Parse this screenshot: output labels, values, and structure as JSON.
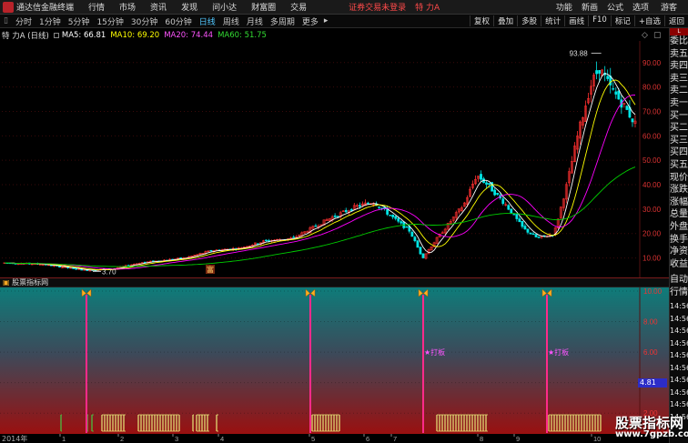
{
  "menu": {
    "app_title": "通达信金融终端",
    "items": [
      "行情",
      "市场",
      "资讯",
      "发现",
      "问小达",
      "财富圈",
      "交易"
    ],
    "warning": "证券交易未登录",
    "stock_name": "特 力A",
    "right_items": [
      "功能",
      "新画",
      "公式",
      "选项",
      "游客"
    ]
  },
  "periods": {
    "items": [
      "分时",
      "1分钟",
      "5分钟",
      "15分钟",
      "30分钟",
      "60分钟",
      "日线",
      "周线",
      "月线",
      "多周期",
      "更多"
    ],
    "active": "日线"
  },
  "tools": [
    "复权",
    "叠加",
    "多股",
    "统计",
    "画线",
    "F10",
    "标记",
    "+自选",
    "返回"
  ],
  "legend": {
    "title": "特 力A (日线)",
    "ma5": "MA5: 66.81",
    "ma10": "MA10: 69.20",
    "ma20": "MA20: 74.44",
    "ma60": "MA60: 51.75"
  },
  "price_axis": [
    "90.00",
    "80.00",
    "70.00",
    "60.00",
    "50.00",
    "40.00",
    "30.00",
    "20.00",
    "10.00"
  ],
  "annotations": {
    "high": "93.88",
    "low": "3.70",
    "ma_marker": "富"
  },
  "indicator": {
    "title": "股票指标网",
    "axis": [
      "10.00",
      "8.00",
      "6.00",
      "4.00",
      "2.00"
    ],
    "current": "4.81",
    "signal_label": "打板"
  },
  "side_panel": {
    "top": "L",
    "labels": [
      "委比",
      "卖五",
      "卖四",
      "卖三",
      "卖二",
      "卖一",
      "买一",
      "买二",
      "买三",
      "买四",
      "买五",
      "现价",
      "涨跌",
      "涨幅",
      "总量",
      "外盘",
      "换手",
      "净资",
      "收益"
    ],
    "section": "自动",
    "section2": "行情",
    "times": [
      "14:56",
      "14:56",
      "14:56",
      "14:56",
      "14:56",
      "14:56",
      "14:56",
      "14:56",
      "14:56",
      "14:56"
    ]
  },
  "date_axis": {
    "year": "2014年",
    "months": [
      "1",
      "2",
      "3",
      "4",
      "5",
      "6",
      "7",
      "8",
      "9",
      "10"
    ]
  },
  "watermark": {
    "line1": "股票指标网",
    "line2": "www.7gpzb.com"
  },
  "colors": {
    "up": "#ff3030",
    "down": "#00e5e5",
    "ma5": "#ffffff",
    "ma10": "#ffff00",
    "ma20": "#ff00ff",
    "ma60": "#00cc00",
    "signal": "#ff2a8a",
    "bar": "#e8e87a"
  }
}
